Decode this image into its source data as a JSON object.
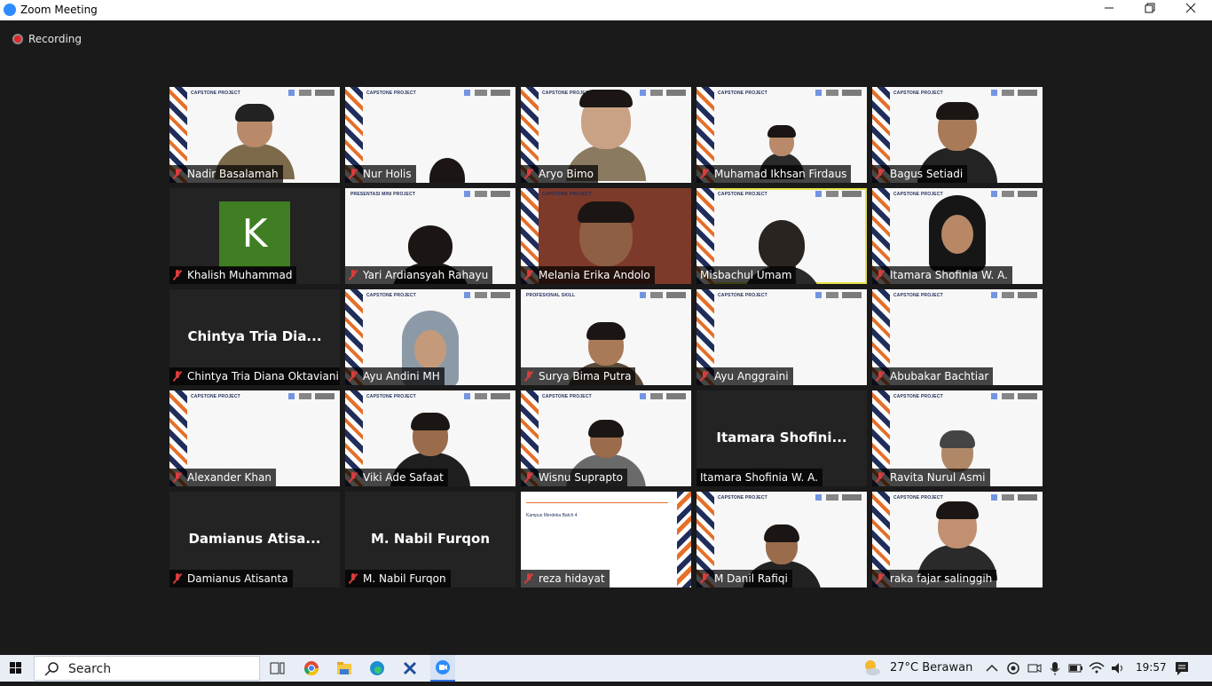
{
  "window": {
    "title": "Zoom Meeting",
    "minimize_icon": "minimize-icon",
    "maximize_icon": "restore-icon",
    "close_icon": "close-icon"
  },
  "meeting": {
    "recording_label": "Recording",
    "speaking_color": "#e6e34a"
  },
  "participants": [
    {
      "name": "Nadir Basalamah",
      "muted": true,
      "video": true
    },
    {
      "name": "Nur Holis",
      "muted": true,
      "video": true
    },
    {
      "name": "Aryo Bimo",
      "muted": true,
      "video": true
    },
    {
      "name": "Muhamad Ikhsan Firdaus",
      "muted": true,
      "video": true
    },
    {
      "name": "Bagus Setiadi",
      "muted": true,
      "video": true
    },
    {
      "name": "Khalish Muhammad",
      "muted": true,
      "video": false,
      "avatar_letter": "K"
    },
    {
      "name": "Yari Ardiansyah Rahayu",
      "muted": true,
      "video": true
    },
    {
      "name": "Melania Erika Andolo",
      "muted": true,
      "video": true
    },
    {
      "name": "Misbachul Umam",
      "muted": false,
      "video": true,
      "speaking": true
    },
    {
      "name": "Itamara Shofinia W. A.",
      "muted": true,
      "video": true
    },
    {
      "name": "Chintya Tria Diana Oktaviani",
      "muted": true,
      "video": false,
      "display_name": "Chintya Tria Dia..."
    },
    {
      "name": "Ayu Andini MH",
      "muted": true,
      "video": true
    },
    {
      "name": "Surya Bima Putra",
      "muted": true,
      "video": true
    },
    {
      "name": "Ayu Anggraini",
      "muted": true,
      "video": true
    },
    {
      "name": "Abubakar Bachtiar",
      "muted": true,
      "video": true
    },
    {
      "name": "Alexander Khan",
      "muted": true,
      "video": true
    },
    {
      "name": "Viki Ade Safaat",
      "muted": true,
      "video": true
    },
    {
      "name": "Wisnu Suprapto",
      "muted": true,
      "video": true
    },
    {
      "name": "Itamara Shofinia W. A.",
      "muted": false,
      "video": false,
      "display_name": "Itamara Shofini..."
    },
    {
      "name": "Ravita Nurul Asmi",
      "muted": true,
      "video": true
    },
    {
      "name": "Damianus Atisanta",
      "muted": true,
      "video": false,
      "display_name": "Damianus Atisa..."
    },
    {
      "name": "M. Nabil Furqon",
      "muted": true,
      "video": false,
      "display_name": "M. Nabil Furqon"
    },
    {
      "name": "reza hidayat",
      "muted": true,
      "video": true
    },
    {
      "name": "M Danil Rafiqi",
      "muted": true,
      "video": true
    },
    {
      "name": "raka fajar salinggih",
      "muted": true,
      "video": true
    }
  ],
  "backgrounds": {
    "capstone_banner": "CAPSTONE PROJECT",
    "mini_project_banner": "PRESENTASI MINI PROJECT",
    "skill_banner": "PROFESIONAL SKILL",
    "kampus_merdeka": "Kampus Merdeka Batch 4"
  },
  "taskbar": {
    "search_label": "Search",
    "weather": "27°C  Berawan",
    "time": "19:57",
    "apps": [
      "windows-start-icon",
      "task-view-icon",
      "chrome-icon",
      "file-explorer-icon",
      "edge-icon",
      "excel-icon",
      "zoom-icon"
    ]
  }
}
